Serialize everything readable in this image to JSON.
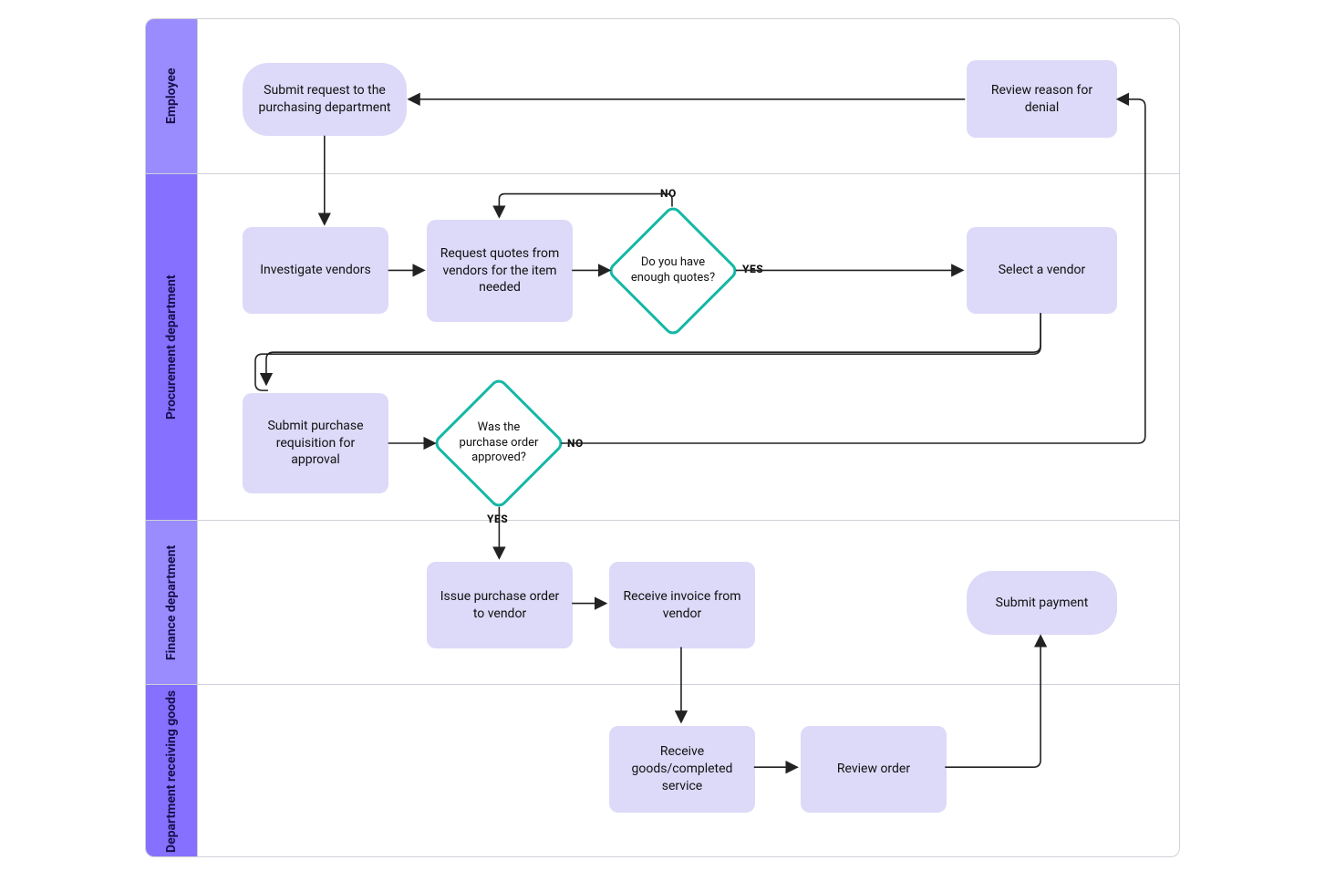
{
  "lanes": {
    "employee": "Employee",
    "procurement": "Procurement department",
    "finance": "Finance department",
    "receiving": "Department receiving goods"
  },
  "nodes": {
    "submit_request": "Submit request to the purchasing department",
    "review_denial": "Review reason for denial",
    "investigate": "Investigate vendors",
    "request_quotes": "Request quotes from vendors for the item needed",
    "enough_quotes": "Do you have enough quotes?",
    "select_vendor": "Select a vendor",
    "submit_req": "Submit purchase requisition for approval",
    "po_approved": "Was the purchase order approved?",
    "issue_po": "Issue purchase order to vendor",
    "receive_invoice": "Receive invoice from vendor",
    "submit_payment": "Submit payment",
    "receive_goods": "Receive goods/completed service",
    "review_order": "Review order"
  },
  "edge_labels": {
    "no": "NO",
    "yes": "YES"
  }
}
